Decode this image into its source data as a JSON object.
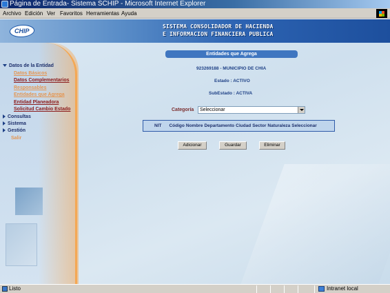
{
  "window": {
    "title": "Página de Entrada- Sistema SCHIP - Microsoft Internet Explorer"
  },
  "menu": {
    "items": [
      "Archivo",
      "Edición",
      "Ver",
      "Favoritos",
      "Herramientas",
      "Ayuda"
    ]
  },
  "header": {
    "logo_text": "CHIP",
    "title_line1": "SISTEMA CONSOLIDADOR DE HACIENDA",
    "title_line2": "E INFORMACION FINANCIERA PUBLICA"
  },
  "sidebar": {
    "sections": [
      {
        "label": "Datos de la Entidad",
        "expanded": true,
        "items": [
          {
            "label": "Datos Básicos",
            "style": "light"
          },
          {
            "label": "Datos Complementarios",
            "style": "dark"
          },
          {
            "label": "Responsables",
            "style": "light"
          },
          {
            "label": "Entidades que Agrega",
            "style": "light"
          },
          {
            "label": "Entidad Planeadora",
            "style": "dark"
          },
          {
            "label": "Solicitud Cambio Estado",
            "style": "dark"
          }
        ]
      },
      {
        "label": "Consultas",
        "expanded": false
      },
      {
        "label": "Sistema",
        "expanded": false
      },
      {
        "label": "Gestión",
        "expanded": false
      }
    ],
    "exit_label": "Salir"
  },
  "content": {
    "section_title": "Entidades que Agrega",
    "entity": "923269188 - MUNICIPIO DE CHIA",
    "estado": "Estado : ACTIVO",
    "subestado": "SubEstado : ACTIVA",
    "categoria_label": "Categoría",
    "categoria_value": "Seleccionar",
    "table_headers": [
      "NIT",
      "Código",
      "Nombre",
      "Departamento",
      "Ciudad",
      "Sector",
      "Naturaleza",
      "Seleccionar"
    ],
    "buttons": {
      "add": "Adicionar",
      "save": "Guardar",
      "delete": "Eliminar"
    }
  },
  "status": {
    "text": "Listo",
    "zone": "Intranet local"
  },
  "colors": {
    "header_blue": "#2d64b3",
    "sidebar_orange": "#f4a64d",
    "section_header": "#3f76c0",
    "link_dark": "#8b1a1a",
    "link_light": "#e49652"
  }
}
